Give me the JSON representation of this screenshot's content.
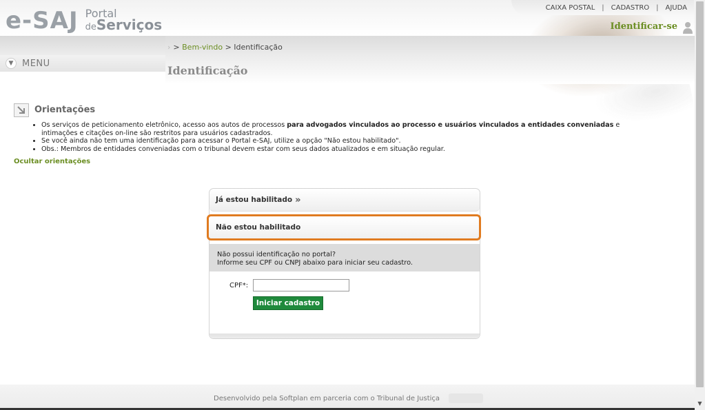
{
  "header": {
    "logo_text": "e-SAJ",
    "logo_sub_portal": "Portal",
    "logo_sub_de": "de",
    "logo_sub_servicos": "Serviços",
    "top_links": [
      "CAIXA POSTAL",
      "CADASTRO",
      "AJUDA"
    ],
    "separator": "|",
    "identify_label": "Identificar-se",
    "menu_label": "MENU"
  },
  "breadcrumb": {
    "prefix": "> ",
    "home": "Bem-vindo",
    "sep": " > ",
    "current": "Identificação"
  },
  "page_title": "Identificação",
  "orientacoes": {
    "title": "Orientações",
    "item1_pre": "Os serviços de peticionamento eletrônico, acesso aos autos de processos ",
    "item1_bold": "para advogados vinculados ao processo e usuários vinculados a entidades conveniadas",
    "item1_post": " e intimações e citações on-line são restritos para usuários cadastrados.",
    "item2": "Se você ainda não tem uma identificação para acessar o Portal e-SAJ, utilize a opção \"Não estou habilitado\".",
    "item3": "Obs.: Membros de entidades conveniadas com o tribunal devem estar com seus dados atualizados e em situação regular.",
    "hide_link": "Ocultar orientações"
  },
  "panel": {
    "tab_enabled": "Já estou habilitado",
    "tab_enabled_arrow": "»",
    "tab_not_enabled": "Não estou habilitado",
    "info_line1": "Não possui identificação no portal?",
    "info_line2": "Informe seu CPF ou CNPJ abaixo para iniciar seu cadastro.",
    "cpf_label": "CPF*:",
    "cpf_value": "",
    "start_button": "Iniciar cadastro"
  },
  "footer": {
    "text": "Desenvolvido pela Softplan em parceria com o Tribunal de Justiça"
  },
  "colors": {
    "accent_green": "#6b8e23",
    "button_green": "#1f8a3c",
    "highlight_orange": "#e07b20"
  }
}
